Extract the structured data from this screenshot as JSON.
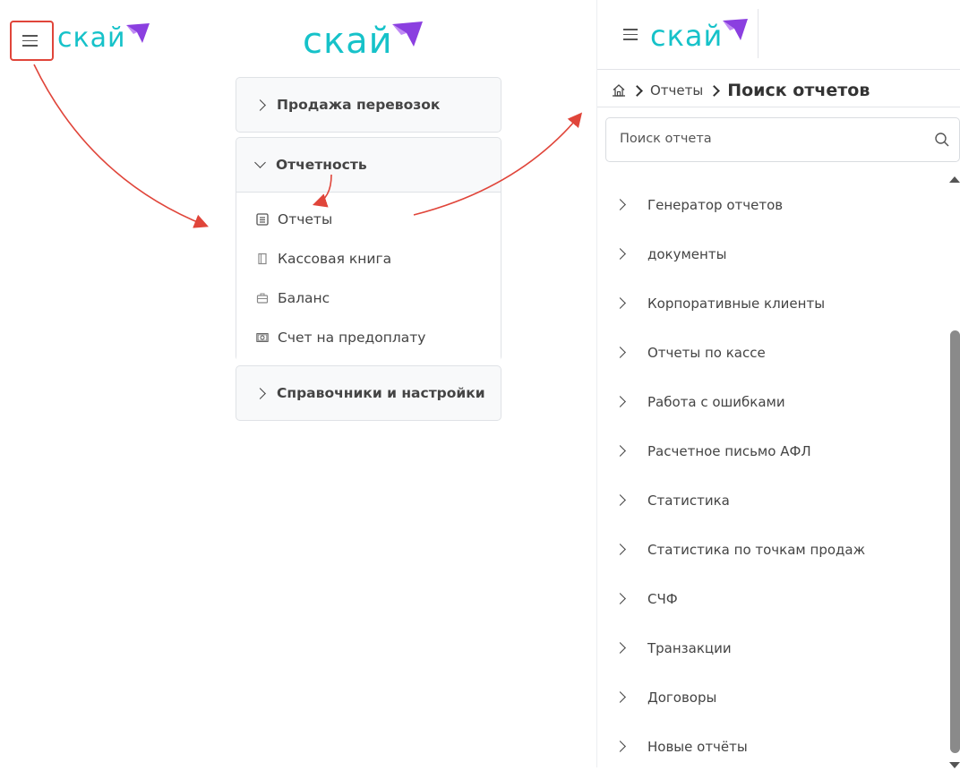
{
  "logo": {
    "text": "скай"
  },
  "menu": {
    "sections": [
      {
        "label": "Продажа перевозок"
      },
      {
        "label": "Отчетность"
      },
      {
        "label": "Справочники и настройки"
      }
    ],
    "reporting_items": [
      {
        "label": "Отчеты",
        "icon": "report-doc-icon"
      },
      {
        "label": "Кассовая книга",
        "icon": "book-icon"
      },
      {
        "label": "Баланс",
        "icon": "briefcase-icon"
      },
      {
        "label": "Счет на предоплату",
        "icon": "money-bill-icon"
      }
    ]
  },
  "breadcrumb": {
    "parent": "Отчеты",
    "current": "Поиск отчетов"
  },
  "search": {
    "placeholder": "Поиск отчета"
  },
  "reports": [
    "Генератор отчетов",
    "документы",
    "Корпоративные клиенты",
    "Отчеты по кассе",
    "Работа с ошибками",
    "Расчетное письмо АФЛ",
    "Статистика",
    "Статистика по точкам продаж",
    "СЧФ",
    "Транзакции",
    "Договоры",
    "Новые отчёты"
  ],
  "colors": {
    "logo_teal": "#16c2c9",
    "logo_purple": "#8b3fe0",
    "highlight_red": "#e0453a",
    "arrow_red": "#e0453a"
  }
}
